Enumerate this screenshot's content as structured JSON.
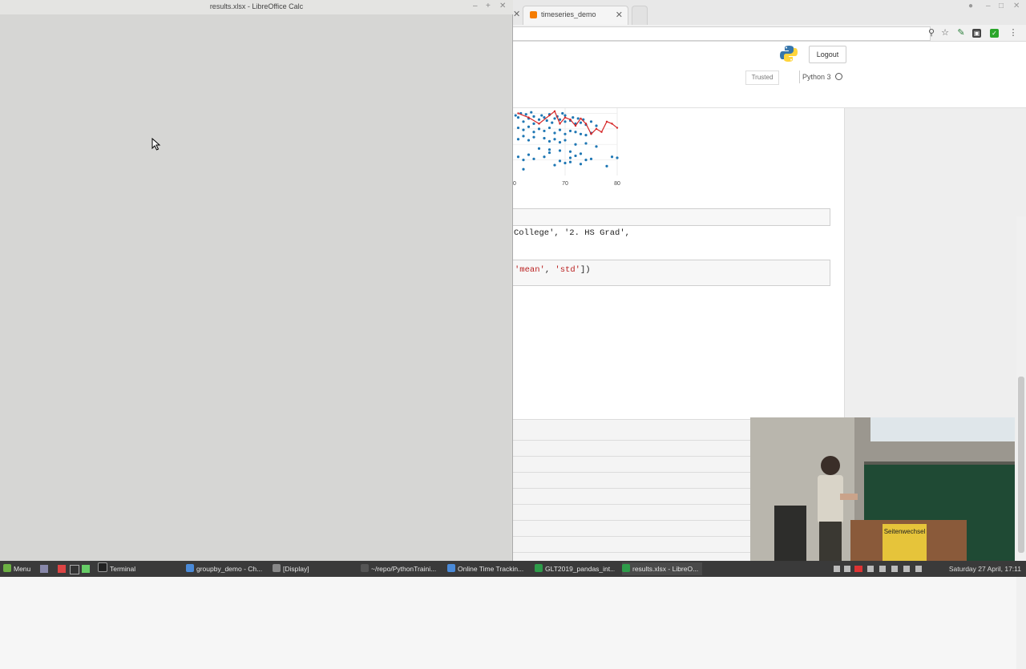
{
  "browser": {
    "tab_title": "timeseries_demo",
    "logout_label": "Logout",
    "trusted_label": "Trusted",
    "kernel_label": "Python 3"
  },
  "chart_data": {
    "type": "scatter",
    "x_ticks": [
      "0",
      "70",
      "80"
    ],
    "series": [
      {
        "kind": "scatter",
        "color": "#1f77b4",
        "x": [
          60.5,
          61,
          61.5,
          62,
          62.5,
          63,
          63.5,
          64,
          64,
          65,
          65.5,
          66,
          66.5,
          67,
          67.5,
          68,
          68.5,
          69,
          69.5,
          70,
          70,
          71,
          71.5,
          72,
          72.5,
          73,
          73.5,
          74,
          75,
          76,
          61,
          62,
          63,
          64,
          65,
          66,
          67,
          68,
          69,
          70,
          71,
          72,
          73,
          74,
          75,
          61,
          62,
          63,
          64,
          66,
          67,
          68,
          69,
          70,
          72,
          74,
          76,
          65,
          67,
          69,
          71,
          73,
          61,
          63,
          67,
          71,
          72,
          75,
          62,
          64,
          66,
          69,
          71,
          62,
          68,
          70,
          73,
          74,
          78,
          79,
          80
        ],
        "y": [
          78,
          76,
          80,
          72,
          79,
          75,
          81,
          77,
          70,
          74,
          78,
          76,
          73,
          79,
          71,
          75,
          77,
          74,
          80,
          72,
          78,
          73,
          76,
          70,
          75,
          71,
          74,
          69,
          72,
          68,
          66,
          64,
          67,
          62,
          65,
          63,
          66,
          61,
          64,
          60,
          63,
          62,
          60,
          59,
          61,
          55,
          58,
          54,
          57,
          56,
          53,
          55,
          52,
          54,
          50,
          51,
          48,
          46,
          45,
          44,
          43,
          41,
          38,
          40,
          42,
          37,
          39,
          36,
          35,
          36,
          38,
          34,
          33,
          26,
          30,
          32,
          31,
          35,
          29,
          38,
          37
        ]
      },
      {
        "kind": "line",
        "color": "#d62728",
        "x": [
          61,
          63,
          65,
          67,
          68,
          69,
          70,
          71,
          72,
          73,
          74,
          75,
          76,
          77,
          78,
          79,
          80
        ],
        "y": [
          80,
          76,
          70,
          78,
          82,
          70,
          76,
          74,
          68,
          75,
          70,
          60,
          65,
          62,
          72,
          70,
          66
        ]
      }
    ],
    "xlim": [
      60,
      80
    ],
    "ylim": [
      20,
      85
    ]
  },
  "cells": {
    "out1": "College', '2. HS Grad',",
    "cell2_open": "'mean'",
    "cell2_sep": ", ",
    "cell2_str2": "'std'",
    "cell2_close": "])"
  },
  "calc": {
    "title": "results.xlsx - LibreOffice Calc"
  },
  "video": {
    "banner_label": "Seitenwechsel"
  },
  "taskbar": {
    "menu": "Menu",
    "items": [
      "Terminal",
      "groupby_demo - Ch...",
      "[Display]",
      "~/repo/PythonTraini...",
      "Online Time Trackin...",
      "GLT2019_pandas_int...",
      "results.xlsx - LibreO..."
    ],
    "clock": "Saturday 27 April, 17:11"
  }
}
